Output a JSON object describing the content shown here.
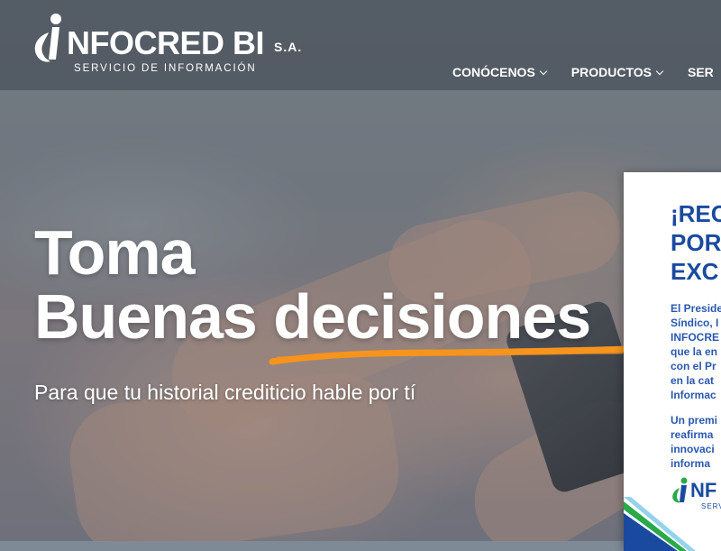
{
  "brand": {
    "name": "NFOCRED BI",
    "suffix": "S.A.",
    "tagline": "SERVICIO DE INFORMACIÓN",
    "accent": "#2aa84a",
    "logo_icon": "person-i-logo-icon"
  },
  "nav": {
    "items": [
      {
        "label": "CONÓCENOS",
        "icon": "chevron-down-icon"
      },
      {
        "label": "PRODUCTOS",
        "icon": "chevron-down-icon"
      },
      {
        "label": "SER",
        "icon": ""
      }
    ]
  },
  "hero": {
    "line1": "Toma",
    "line2": "Buenas decisiones",
    "subtitle": "Para que tu historial crediticio hable por tí",
    "underline_color": "#f7941d"
  },
  "promo": {
    "heading": "¡REC\nPOR\nEXC",
    "body1": "El Preside\nSíndico, I\nINFOCRE\nque la en\ncon el Pr\nen la cat\nInformac",
    "body2": "Un premi\nreafirma\ninnovaci\ninforma",
    "logo_text": "NF",
    "logo_tag": "SERV",
    "heading_color": "#1a4aa0"
  }
}
